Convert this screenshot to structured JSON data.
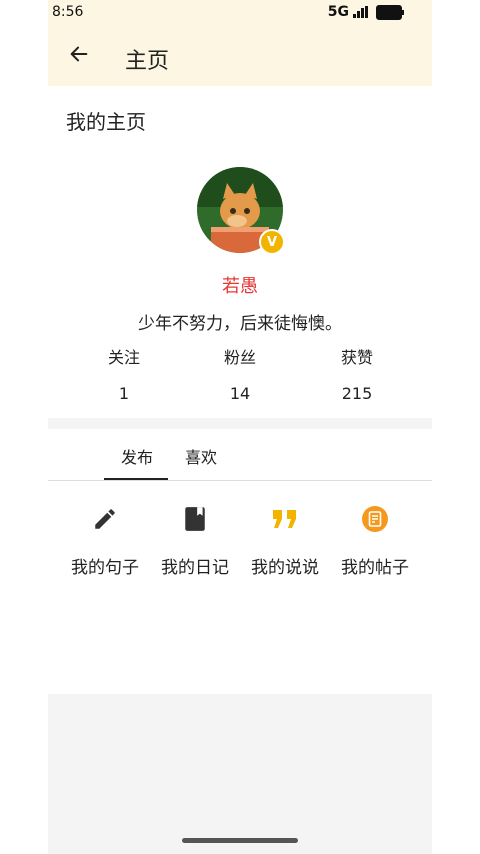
{
  "status_bar": {
    "time": "8:56",
    "network": "5G"
  },
  "app_bar": {
    "title": "主页",
    "back_icon": "arrow-left-icon"
  },
  "section": {
    "title": "我的主页"
  },
  "profile": {
    "username": "若愚",
    "bio": "少年不努力，后来徒悔懊。",
    "verified_badge": "V"
  },
  "stats": [
    {
      "label": "关注",
      "value": "1"
    },
    {
      "label": "粉丝",
      "value": "14"
    },
    {
      "label": "获赞",
      "value": "215"
    }
  ],
  "tabs": [
    {
      "label": "发布",
      "active": true
    },
    {
      "label": "喜欢",
      "active": false
    }
  ],
  "items": [
    {
      "label": "我的句子",
      "icon": "pencil-icon"
    },
    {
      "label": "我的日记",
      "icon": "book-icon"
    },
    {
      "label": "我的说说",
      "icon": "quote-icon"
    },
    {
      "label": "我的帖子",
      "icon": "post-icon"
    }
  ],
  "colors": {
    "appbar_bg": "#fdf6e3",
    "username": "#e53935",
    "accent": "#f3b400"
  }
}
